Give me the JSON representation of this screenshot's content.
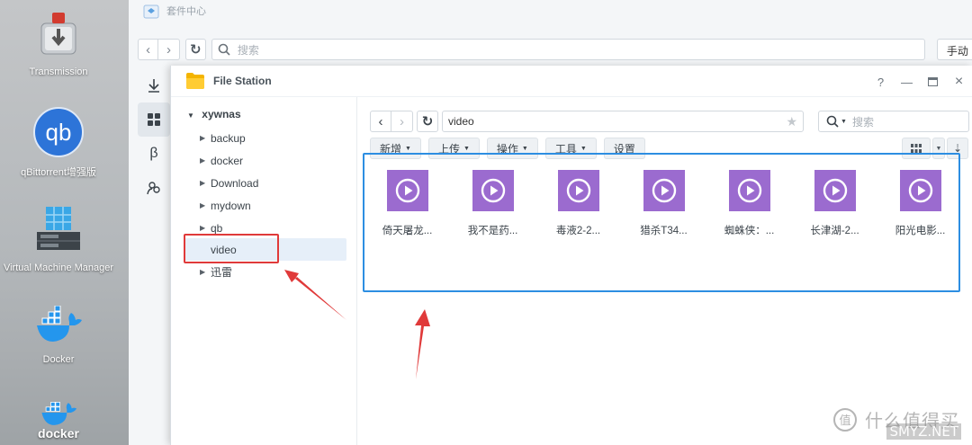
{
  "desktop": {
    "icons": [
      {
        "label": "Transmission"
      },
      {
        "label": "qBittorrent增强版"
      },
      {
        "label": "Virtual Machine Manager"
      },
      {
        "label": "Docker"
      },
      {
        "label": "docker"
      }
    ]
  },
  "package_center": {
    "title": "套件中心",
    "search_placeholder": "搜索",
    "manual_button": "手动"
  },
  "file_station": {
    "title": "File Station",
    "help": "?",
    "tree": {
      "root": "xywnas",
      "folders": [
        "backup",
        "docker",
        "Download",
        "mydown",
        "qb",
        "video",
        "迅雷"
      ],
      "selected": "video"
    },
    "path": "video",
    "search_placeholder": "搜索",
    "actions": [
      "新增",
      "上传",
      "操作",
      "工具",
      "设置"
    ],
    "files": [
      "倚天屠龙...",
      "我不是药...",
      "毒液2-2...",
      "猎杀T34...",
      "蜘蛛侠：...",
      "长津湖-2...",
      "阳光电影..."
    ]
  },
  "watermark": {
    "text": "什么值得买",
    "sub": "SMYZ.NET"
  },
  "colors": {
    "accent_blue": "#2d8ee2",
    "annotation_red": "#e03a3a",
    "video_thumb": "#9b6bcf"
  }
}
